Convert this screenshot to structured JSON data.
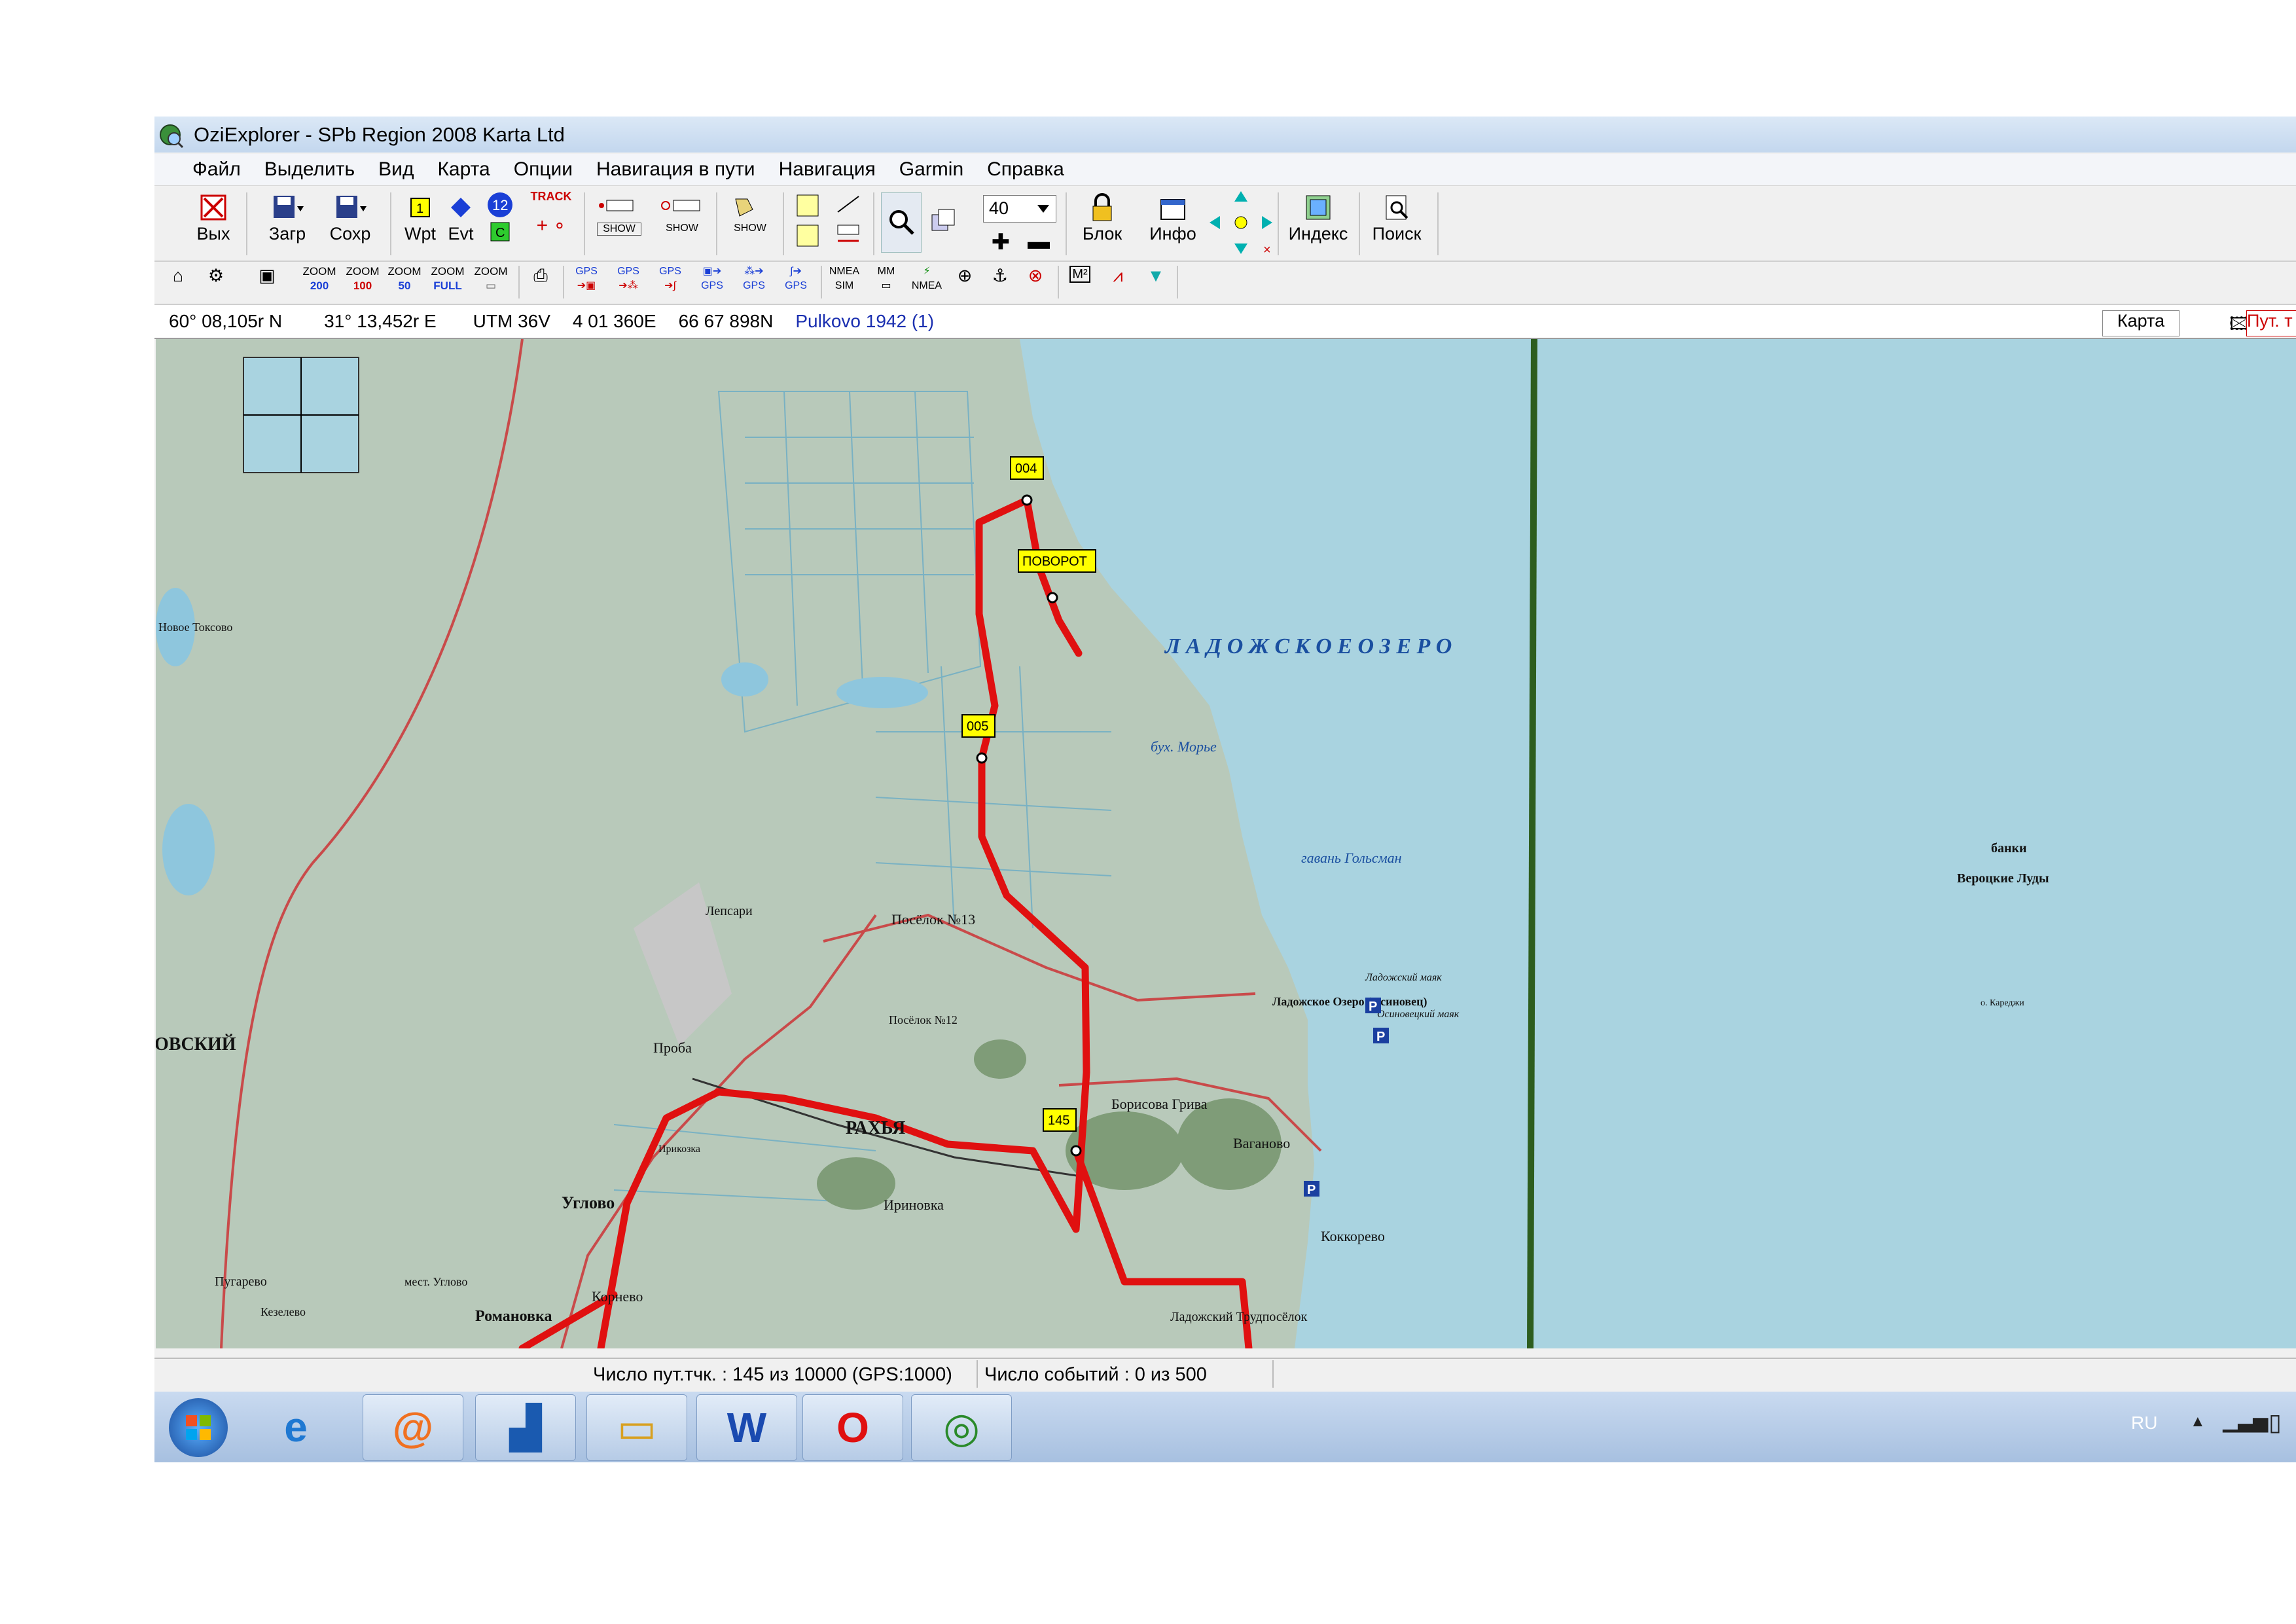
{
  "window": {
    "title": "OziExplorer - SPb Region 2008 Karta Ltd"
  },
  "menu": [
    "Файл",
    "Выделить",
    "Вид",
    "Карта",
    "Опции",
    "Навигация в пути",
    "Навигация",
    "Garmin",
    "Справка"
  ],
  "toolbar": {
    "exit": "Вых",
    "load": "Загр",
    "save": "Сохр",
    "wpt": "Wpt",
    "evt": "Evt",
    "track_label": "TRACK",
    "show_label": "SHOW",
    "zoom_value": "40",
    "lock": "Блок",
    "info": "Инфо",
    "index": "Индекс",
    "search": "Поиск"
  },
  "toolbar2": {
    "zoom200": "200",
    "zoom100": "100",
    "zoom50": "50",
    "zoom_full": "FULL",
    "zoom": "ZOOM",
    "gps": "GPS",
    "nmea": "NMEA",
    "sim": "SIM",
    "mm": "MM",
    "m2": "M²"
  },
  "coords": {
    "lat": "60° 08,105r N",
    "lon": "31° 13,452r E",
    "utm": "UTM  36V",
    "easting": "4 01 360E",
    "northing": "66 67 898N",
    "datum": "Pulkovo 1942 (1)",
    "map_tab": "Карта",
    "route_tab": "Пут. т"
  },
  "map": {
    "waypoints": [
      "004",
      "ПОВОРОТ",
      "005",
      "145"
    ],
    "lake": "Л А Д О Ж С К О Е   О З Е Р О",
    "places": [
      "РАХЬЯ",
      "Углово",
      "Романовка",
      "Корнево",
      "Ириновка",
      "Борисова Грива",
      "Ваганово",
      "Коккорево",
      "Ладожский Трудпосёлок",
      "Посёлок №13",
      "Посёлок №12",
      "Проба",
      "Лепсари",
      "Новое Токсово",
      "Ладожское Озеро (Осиновец)",
      "бух. Морье",
      "гавань Гольсман",
      "ОВСКИЙ",
      "Пугарево",
      "Кезелево",
      "мест. Углово",
      "Ирикозка",
      "Осиновецкий маяк",
      "Ладожский маяк",
      "о. Кареджи"
    ],
    "banks_title": "банки",
    "banks_name": "Вероцкие Луды"
  },
  "status": {
    "points": "Число пут.тчк. : 145 из 10000  (GPS:1000)",
    "events": "Число событий : 0 из 500"
  },
  "taskbar": {
    "lang": "RU"
  }
}
